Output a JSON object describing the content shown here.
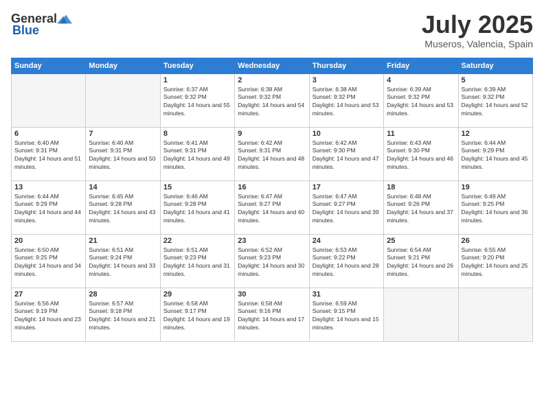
{
  "header": {
    "logo_general": "General",
    "logo_blue": "Blue",
    "month": "July 2025",
    "location": "Museros, Valencia, Spain"
  },
  "days_of_week": [
    "Sunday",
    "Monday",
    "Tuesday",
    "Wednesday",
    "Thursday",
    "Friday",
    "Saturday"
  ],
  "weeks": [
    [
      {
        "day": "",
        "empty": true
      },
      {
        "day": "",
        "empty": true
      },
      {
        "day": "1",
        "sunrise": "6:37 AM",
        "sunset": "9:32 PM",
        "daylight": "14 hours and 55 minutes."
      },
      {
        "day": "2",
        "sunrise": "6:38 AM",
        "sunset": "9:32 PM",
        "daylight": "14 hours and 54 minutes."
      },
      {
        "day": "3",
        "sunrise": "6:38 AM",
        "sunset": "9:32 PM",
        "daylight": "14 hours and 53 minutes."
      },
      {
        "day": "4",
        "sunrise": "6:39 AM",
        "sunset": "9:32 PM",
        "daylight": "14 hours and 53 minutes."
      },
      {
        "day": "5",
        "sunrise": "6:39 AM",
        "sunset": "9:32 PM",
        "daylight": "14 hours and 52 minutes."
      }
    ],
    [
      {
        "day": "6",
        "sunrise": "6:40 AM",
        "sunset": "9:31 PM",
        "daylight": "14 hours and 51 minutes."
      },
      {
        "day": "7",
        "sunrise": "6:40 AM",
        "sunset": "9:31 PM",
        "daylight": "14 hours and 50 minutes."
      },
      {
        "day": "8",
        "sunrise": "6:41 AM",
        "sunset": "9:31 PM",
        "daylight": "14 hours and 49 minutes."
      },
      {
        "day": "9",
        "sunrise": "6:42 AM",
        "sunset": "9:31 PM",
        "daylight": "14 hours and 48 minutes."
      },
      {
        "day": "10",
        "sunrise": "6:42 AM",
        "sunset": "9:30 PM",
        "daylight": "14 hours and 47 minutes."
      },
      {
        "day": "11",
        "sunrise": "6:43 AM",
        "sunset": "9:30 PM",
        "daylight": "14 hours and 46 minutes."
      },
      {
        "day": "12",
        "sunrise": "6:44 AM",
        "sunset": "9:29 PM",
        "daylight": "14 hours and 45 minutes."
      }
    ],
    [
      {
        "day": "13",
        "sunrise": "6:44 AM",
        "sunset": "9:29 PM",
        "daylight": "14 hours and 44 minutes."
      },
      {
        "day": "14",
        "sunrise": "6:45 AM",
        "sunset": "9:28 PM",
        "daylight": "14 hours and 43 minutes."
      },
      {
        "day": "15",
        "sunrise": "6:46 AM",
        "sunset": "9:28 PM",
        "daylight": "14 hours and 41 minutes."
      },
      {
        "day": "16",
        "sunrise": "6:47 AM",
        "sunset": "9:27 PM",
        "daylight": "14 hours and 40 minutes."
      },
      {
        "day": "17",
        "sunrise": "6:47 AM",
        "sunset": "9:27 PM",
        "daylight": "14 hours and 39 minutes."
      },
      {
        "day": "18",
        "sunrise": "6:48 AM",
        "sunset": "9:26 PM",
        "daylight": "14 hours and 37 minutes."
      },
      {
        "day": "19",
        "sunrise": "6:49 AM",
        "sunset": "9:25 PM",
        "daylight": "14 hours and 36 minutes."
      }
    ],
    [
      {
        "day": "20",
        "sunrise": "6:50 AM",
        "sunset": "9:25 PM",
        "daylight": "14 hours and 34 minutes."
      },
      {
        "day": "21",
        "sunrise": "6:51 AM",
        "sunset": "9:24 PM",
        "daylight": "14 hours and 33 minutes."
      },
      {
        "day": "22",
        "sunrise": "6:51 AM",
        "sunset": "9:23 PM",
        "daylight": "14 hours and 31 minutes."
      },
      {
        "day": "23",
        "sunrise": "6:52 AM",
        "sunset": "9:23 PM",
        "daylight": "14 hours and 30 minutes."
      },
      {
        "day": "24",
        "sunrise": "6:53 AM",
        "sunset": "9:22 PM",
        "daylight": "14 hours and 28 minutes."
      },
      {
        "day": "25",
        "sunrise": "6:54 AM",
        "sunset": "9:21 PM",
        "daylight": "14 hours and 26 minutes."
      },
      {
        "day": "26",
        "sunrise": "6:55 AM",
        "sunset": "9:20 PM",
        "daylight": "14 hours and 25 minutes."
      }
    ],
    [
      {
        "day": "27",
        "sunrise": "6:56 AM",
        "sunset": "9:19 PM",
        "daylight": "14 hours and 23 minutes."
      },
      {
        "day": "28",
        "sunrise": "6:57 AM",
        "sunset": "9:18 PM",
        "daylight": "14 hours and 21 minutes."
      },
      {
        "day": "29",
        "sunrise": "6:58 AM",
        "sunset": "9:17 PM",
        "daylight": "14 hours and 19 minutes."
      },
      {
        "day": "30",
        "sunrise": "6:58 AM",
        "sunset": "9:16 PM",
        "daylight": "14 hours and 17 minutes."
      },
      {
        "day": "31",
        "sunrise": "6:59 AM",
        "sunset": "9:15 PM",
        "daylight": "14 hours and 15 minutes."
      },
      {
        "day": "",
        "empty": true
      },
      {
        "day": "",
        "empty": true
      }
    ]
  ]
}
